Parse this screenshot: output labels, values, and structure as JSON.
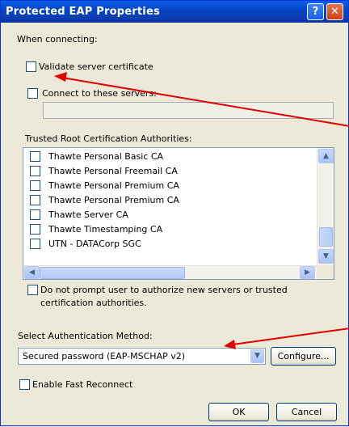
{
  "window": {
    "title": "Protected EAP Properties",
    "help_glyph": "?",
    "close_glyph": "✕"
  },
  "connecting": {
    "heading": "When connecting:",
    "validate_label": "Validate server certificate",
    "validate_checked": false,
    "connect_label": "Connect to these servers:",
    "connect_checked": false,
    "servers_value": ""
  },
  "trusted_root": {
    "heading": "Trusted Root Certification Authorities:",
    "items": [
      {
        "label": "Thawte Personal Basic CA",
        "checked": false
      },
      {
        "label": "Thawte Personal Freemail CA",
        "checked": false
      },
      {
        "label": "Thawte Personal Premium CA",
        "checked": false
      },
      {
        "label": "Thawte Personal Premium CA",
        "checked": false
      },
      {
        "label": "Thawte Server CA",
        "checked": false
      },
      {
        "label": "Thawte Timestamping CA",
        "checked": false
      },
      {
        "label": "UTN - DATACorp SGC",
        "checked": false
      }
    ]
  },
  "prompt": {
    "line1": "Do not prompt user to authorize new servers or trusted",
    "line2": "certification authorities.",
    "checked": false
  },
  "auth": {
    "heading": "Select Authentication Method:",
    "selected": "Secured password (EAP-MSCHAP v2)",
    "configure_label": "Configure..."
  },
  "fast_reconnect": {
    "label": "Enable Fast Reconnect",
    "checked": false
  },
  "footer": {
    "ok_label": "OK",
    "cancel_label": "Cancel"
  },
  "scroll_glyphs": {
    "up": "▲",
    "down": "▼",
    "left": "◀",
    "right": "▶"
  },
  "colors": {
    "annotation_arrow": "#e00000",
    "titlebar": "#0542c2"
  }
}
